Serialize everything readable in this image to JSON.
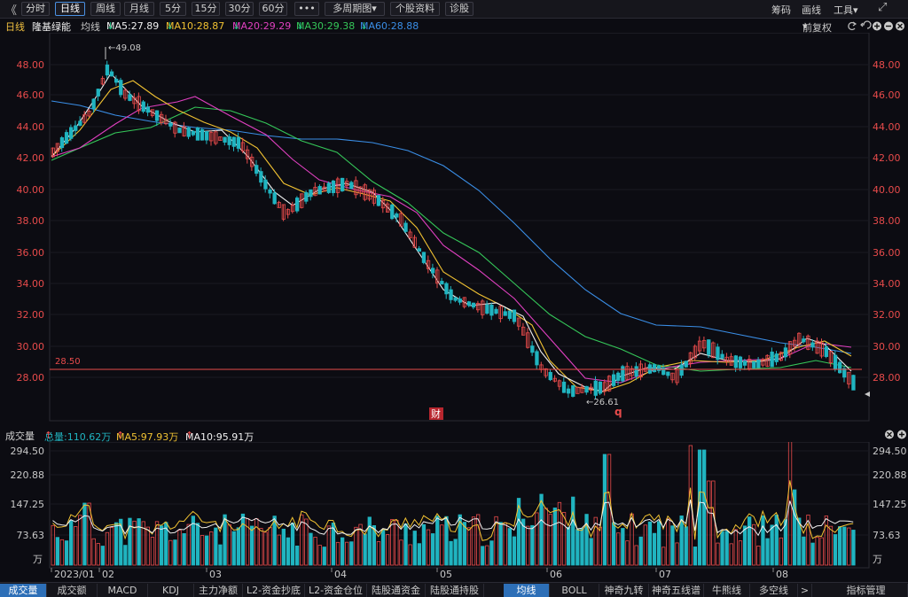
{
  "toolbar": {
    "back": "《",
    "periods": [
      "分时",
      "日线",
      "周线",
      "月线",
      "5分",
      "15分",
      "30分",
      "60分"
    ],
    "more": "•••",
    "multi_period": "多周期图",
    "multi_period_arrow": "▾",
    "stock_info": "个股资料",
    "diagnose": "诊股",
    "right_links": [
      "筹码",
      "画线",
      "工具"
    ],
    "tools_arrow": "▾",
    "expand_icon": "⤢"
  },
  "infobar": {
    "period": "日线",
    "stock_name": "隆基绿能",
    "avg_label": "均线",
    "ma": [
      {
        "label": "MA5:27.89",
        "arrow": "↓",
        "color": "#f0f0f0"
      },
      {
        "label": "MA10:28.87",
        "arrow": "↓",
        "color": "#f1c232"
      },
      {
        "label": "MA20:29.29",
        "arrow": "↓",
        "color": "#e040c0"
      },
      {
        "label": "MA30:29.38",
        "arrow": "↓",
        "color": "#35c759"
      },
      {
        "label": "MA60:28.88",
        "arrow": "↓",
        "color": "#3a8ee6"
      }
    ],
    "adjust": "前复权",
    "adjust_arrow": "▾"
  },
  "price_axis": {
    "ticks": [
      "48.00",
      "46.00",
      "44.00",
      "42.00",
      "40.00",
      "38.00",
      "36.00",
      "34.00",
      "32.00",
      "30.00",
      "28.00"
    ],
    "ref_line": "28.50",
    "high_label": "49.08",
    "low_label": "26.61",
    "cai_marker": "财",
    "q_marker": "q"
  },
  "volume": {
    "title": "成交量",
    "total": "总量:110.62万",
    "total_arrow": "↑",
    "ma5": "MA5:97.93万",
    "ma5_arrow": "↑",
    "ma10": "MA10:95.91万",
    "ma10_arrow": "↑",
    "ticks": [
      "294.50",
      "220.88",
      "147.25",
      "73.63"
    ],
    "unit": "万"
  },
  "date_axis": [
    "2023/01",
    "02",
    "03",
    "04",
    "05",
    "06",
    "07",
    "08"
  ],
  "tabs_left": [
    "成交量",
    "成交额",
    "MACD",
    "KDJ",
    "主力净额",
    "L2-资金抄底",
    "L2-资金仓位",
    "陆股通资金",
    "陆股通持股"
  ],
  "tabs_right": [
    "均线",
    "BOLL",
    "神奇九转",
    "神奇五线谱",
    "牛熊线",
    "多空线"
  ],
  "tabs_more": ">",
  "tabs_manage": "指标管理",
  "colors": {
    "up": "#e84b4b",
    "down": "#20b4c0",
    "ma5": "#f0f0f0",
    "ma10": "#f1c232",
    "ma20": "#e040c0",
    "ma30": "#35c759",
    "ma60": "#3a8ee6"
  }
}
